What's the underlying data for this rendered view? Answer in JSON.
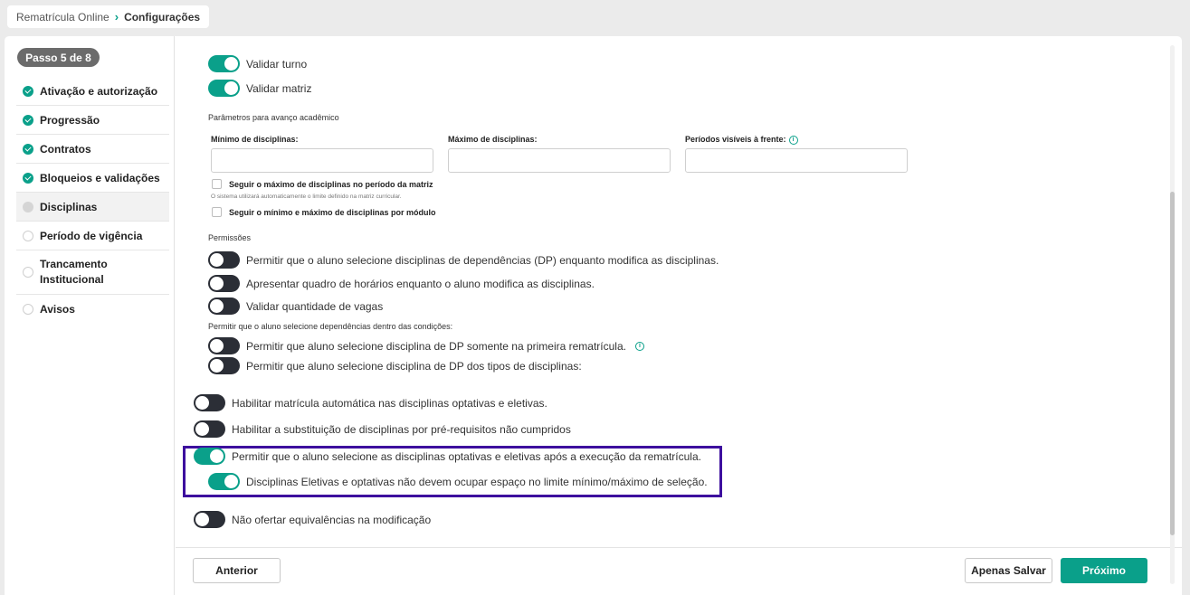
{
  "breadcrumb": {
    "root": "Rematrícula Online",
    "separator": "›",
    "current": "Configurações"
  },
  "sidebar": {
    "step_badge": "Passo 5 de 8",
    "items": [
      {
        "label": "Ativação e autorização",
        "status": "done"
      },
      {
        "label": "Progressão",
        "status": "done"
      },
      {
        "label": "Contratos",
        "status": "done"
      },
      {
        "label": "Bloqueios e validações",
        "status": "done"
      },
      {
        "label": "Disciplinas",
        "status": "current"
      },
      {
        "label": "Período de vigência",
        "status": "pending"
      },
      {
        "label": "Trancamento Institucional",
        "status": "pending"
      },
      {
        "label": "Avisos",
        "status": "pending"
      }
    ]
  },
  "toggles_top": [
    {
      "label": "Validar turno",
      "on": true
    },
    {
      "label": "Validar matriz",
      "on": true
    }
  ],
  "academic": {
    "section_title": "Parâmetros para avanço acadêmico",
    "min_label": "Mínimo de disciplinas:",
    "max_label": "Máximo de disciplinas:",
    "periods_label": "Períodos visíveis à frente:",
    "min_value": "",
    "max_value": "",
    "periods_value": "",
    "checkbox_max_period": "Seguir o máximo de disciplinas no período da matriz",
    "hint_max_period": "O sistema utilizará automaticamente o limite definido na matriz curricular.",
    "checkbox_module": "Seguir o mínimo e máximo de disciplinas por módulo"
  },
  "permissions": {
    "section_title": "Permissões",
    "toggles": [
      {
        "label": "Permitir que o aluno selecione disciplinas de dependências (DP) enquanto modifica as disciplinas.",
        "on": false
      },
      {
        "label": "Apresentar quadro de horários enquanto o aluno modifica as disciplinas.",
        "on": false
      },
      {
        "label": "Validar quantidade de vagas",
        "on": false
      }
    ],
    "dp_conditions_title": "Permitir que o aluno selecione dependências dentro das condições:",
    "dp_toggles": [
      {
        "label": "Permitir que aluno selecione disciplina de DP somente na primeira rematrícula.",
        "on": false
      },
      {
        "label": "Permitir que aluno selecione disciplina de DP dos tipos de disciplinas:",
        "on": false
      }
    ]
  },
  "general_toggles": [
    {
      "label": "Habilitar matrícula automática nas disciplinas optativas e eletivas.",
      "on": false
    },
    {
      "label": "Habilitar a substituição de disciplinas por pré-requisitos não cumpridos",
      "on": false
    },
    {
      "label": "Permitir que o aluno selecione as disciplinas optativas e eletivas após a execução da rematrícula.",
      "on": true
    },
    {
      "label": "Disciplinas Eletivas e optativas não devem ocupar espaço no limite mínimo/máximo de seleção.",
      "on": true
    },
    {
      "label": "Não ofertar equivalências na modificação",
      "on": false
    }
  ],
  "footer": {
    "back_label": "Anterior",
    "save_label": "Apenas Salvar",
    "next_label": "Próximo"
  },
  "colors": {
    "accent": "#0aa08a",
    "toggle_off": "#2b2e36",
    "highlight": "#3d0e9e"
  }
}
